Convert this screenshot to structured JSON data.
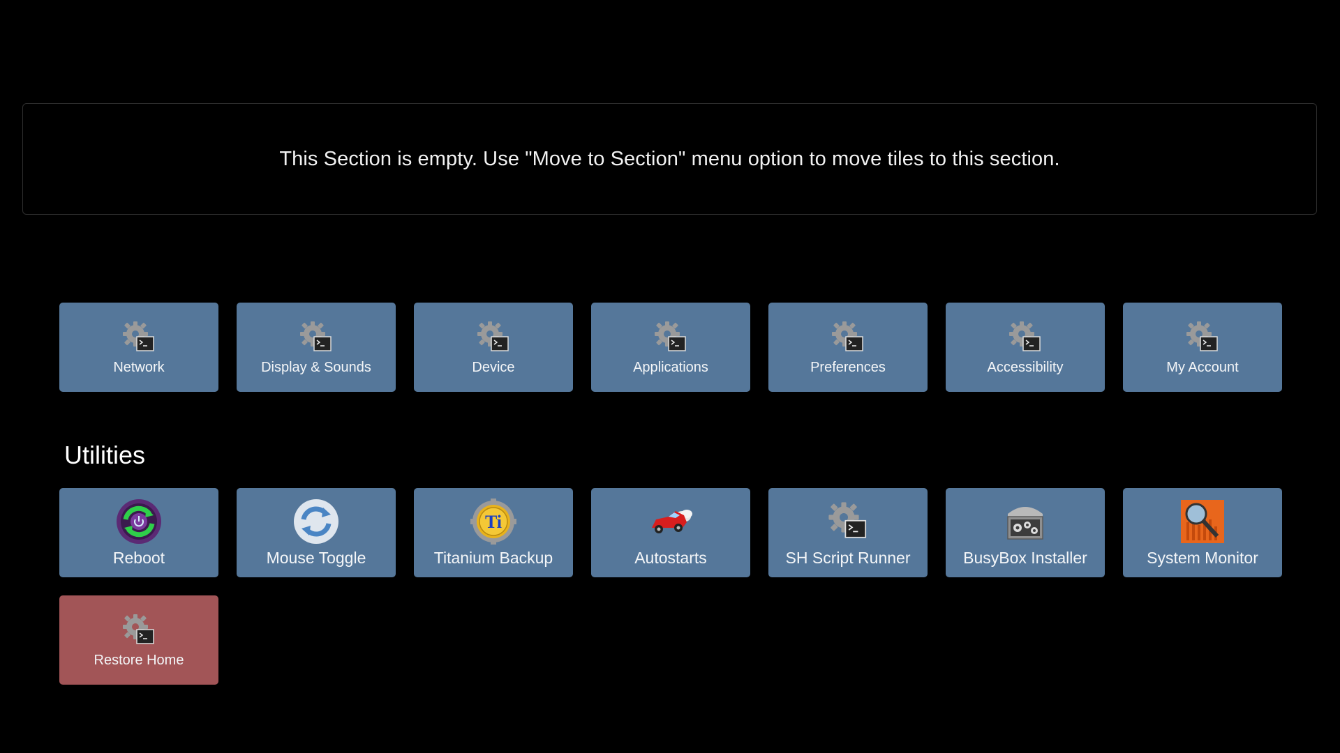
{
  "empty_section": {
    "message": "This Section is empty. Use \"Move to Section\" menu option to move tiles to this section."
  },
  "settings_tiles": [
    {
      "label": "Network",
      "icon": "settings-terminal-icon"
    },
    {
      "label": "Display & Sounds",
      "icon": "settings-terminal-icon"
    },
    {
      "label": "Device",
      "icon": "settings-terminal-icon"
    },
    {
      "label": "Applications",
      "icon": "settings-terminal-icon"
    },
    {
      "label": "Preferences",
      "icon": "settings-terminal-icon"
    },
    {
      "label": "Accessibility",
      "icon": "settings-terminal-icon"
    },
    {
      "label": "My Account",
      "icon": "settings-terminal-icon"
    }
  ],
  "utilities": {
    "title": "Utilities",
    "tiles": [
      {
        "label": "Reboot",
        "icon": "reboot-icon"
      },
      {
        "label": "Mouse Toggle",
        "icon": "mouse-toggle-icon"
      },
      {
        "label": "Titanium Backup",
        "icon": "titanium-backup-icon"
      },
      {
        "label": "Autostarts",
        "icon": "autostarts-icon"
      },
      {
        "label": "SH Script Runner",
        "icon": "settings-terminal-icon"
      },
      {
        "label": "BusyBox Installer",
        "icon": "busybox-icon"
      },
      {
        "label": "System Monitor",
        "icon": "system-monitor-icon"
      }
    ],
    "restore_tile": {
      "label": "Restore Home",
      "icon": "settings-terminal-icon"
    }
  },
  "colors": {
    "background": "#000000",
    "tile": "#55779a",
    "restore_tile": "#a25557"
  }
}
